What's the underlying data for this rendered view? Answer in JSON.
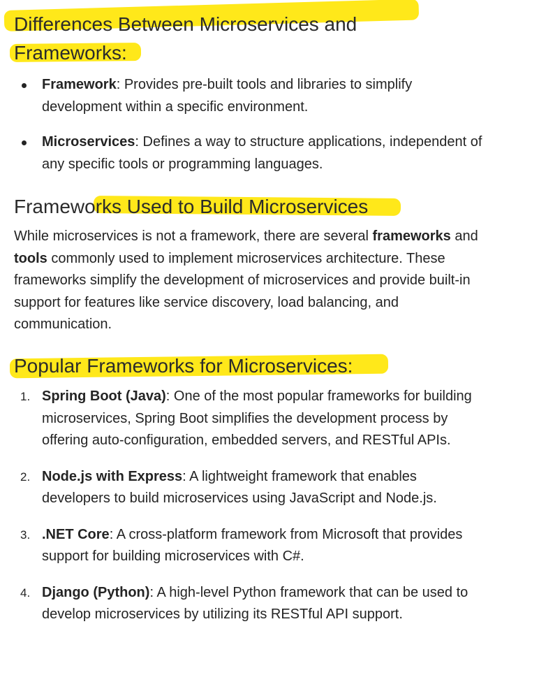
{
  "section1": {
    "heading_line1": "Differences Between Microservices and",
    "heading_line2": "Frameworks:",
    "items": [
      {
        "term": "Framework",
        "text": ": Provides pre-built tools and libraries to simplify development within a specific environment."
      },
      {
        "term": "Microservices",
        "text": ": Defines a way to structure applications, independent of any specific tools or programming languages."
      }
    ]
  },
  "section2": {
    "heading": "Frameworks Used to Build Microservices",
    "paragraph": {
      "part1": "While microservices is not a framework, there are several ",
      "bold1": "frameworks",
      "part2": " and ",
      "bold2": "tools",
      "part3": " commonly used to implement microservices architecture. These frameworks simplify the development of microservices and provide built-in support for features like service discovery, load balancing, and communication."
    }
  },
  "section3": {
    "heading": "Popular Frameworks for Microservices:",
    "items": [
      {
        "number": "1.",
        "term": "Spring Boot (Java)",
        "text": ": One of the most popular frameworks for building microservices, Spring Boot simplifies the development process by offering auto-configuration, embedded servers, and RESTful APIs."
      },
      {
        "number": "2.",
        "term": "Node.js with Express",
        "text": ": A lightweight framework that enables developers to build microservices using JavaScript and Node.js."
      },
      {
        "number": "3.",
        "term": ".NET Core",
        "text": ": A cross-platform framework from Microsoft that provides support for building microservices with C#."
      },
      {
        "number": "4.",
        "term": "Django (Python)",
        "text": ": A high-level Python framework that can be used to develop microservices by utilizing its RESTful API support."
      }
    ]
  },
  "colors": {
    "highlight": "#ffe81a",
    "text": "#242424"
  }
}
